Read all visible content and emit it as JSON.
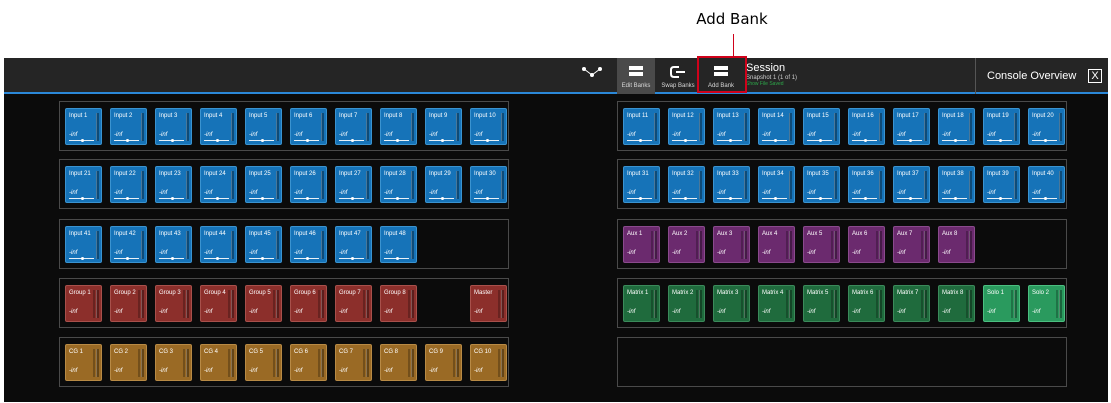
{
  "annotation": {
    "label": "Add Bank"
  },
  "toolbar": {
    "routing_icon": "routing-icon",
    "edit_banks": "Edit Banks",
    "swap_banks": "Swap Banks",
    "add_bank": "Add Bank",
    "session_title": "Session",
    "session_sub": "Snapshot 1 (1 of 1)",
    "session_status": "Show File Saved",
    "console_overview": "Console Overview",
    "close_label": "X"
  },
  "left_banks": [
    {
      "kind": "input",
      "tiles": [
        {
          "name": "Input 1",
          "level": "-inf"
        },
        {
          "name": "Input 2",
          "level": "-inf"
        },
        {
          "name": "Input 3",
          "level": "-inf"
        },
        {
          "name": "Input 4",
          "level": "-inf"
        },
        {
          "name": "Input 5",
          "level": "-inf"
        },
        {
          "name": "Input 6",
          "level": "-inf"
        },
        {
          "name": "Input 7",
          "level": "-inf"
        },
        {
          "name": "Input 8",
          "level": "-inf"
        },
        {
          "name": "Input 9",
          "level": "-inf"
        },
        {
          "name": "Input 10",
          "level": "-inf"
        }
      ]
    },
    {
      "kind": "input",
      "tiles": [
        {
          "name": "Input 21",
          "level": "-inf"
        },
        {
          "name": "Input 22",
          "level": "-inf"
        },
        {
          "name": "Input 23",
          "level": "-inf"
        },
        {
          "name": "Input 24",
          "level": "-inf"
        },
        {
          "name": "Input 25",
          "level": "-inf"
        },
        {
          "name": "Input 26",
          "level": "-inf"
        },
        {
          "name": "Input 27",
          "level": "-inf"
        },
        {
          "name": "Input 28",
          "level": "-inf"
        },
        {
          "name": "Input 29",
          "level": "-inf"
        },
        {
          "name": "Input 30",
          "level": "-inf"
        }
      ]
    },
    {
      "kind": "input",
      "tiles": [
        {
          "name": "Input 41",
          "level": "-inf"
        },
        {
          "name": "Input 42",
          "level": "-inf"
        },
        {
          "name": "Input 43",
          "level": "-inf"
        },
        {
          "name": "Input 44",
          "level": "-inf"
        },
        {
          "name": "Input 45",
          "level": "-inf"
        },
        {
          "name": "Input 46",
          "level": "-inf"
        },
        {
          "name": "Input 47",
          "level": "-inf"
        },
        {
          "name": "Input 48",
          "level": "-inf"
        }
      ]
    },
    {
      "kind": "group",
      "tiles": [
        {
          "name": "Group 1",
          "level": "-inf"
        },
        {
          "name": "Group 2",
          "level": "-inf"
        },
        {
          "name": "Group 3",
          "level": "-inf"
        },
        {
          "name": "Group 4",
          "level": "-inf"
        },
        {
          "name": "Group 5",
          "level": "-inf"
        },
        {
          "name": "Group 6",
          "level": "-inf"
        },
        {
          "name": "Group 7",
          "level": "-inf"
        },
        {
          "name": "Group 8",
          "level": "-inf"
        },
        {
          "name": "",
          "level": ""
        },
        {
          "name": "Master",
          "level": "-inf"
        }
      ]
    },
    {
      "kind": "cg",
      "tiles": [
        {
          "name": "CG 1",
          "level": "-inf"
        },
        {
          "name": "CG 2",
          "level": "-inf"
        },
        {
          "name": "CG 3",
          "level": "-inf"
        },
        {
          "name": "CG 4",
          "level": "-inf"
        },
        {
          "name": "CG 5",
          "level": "-inf"
        },
        {
          "name": "CG 6",
          "level": "-inf"
        },
        {
          "name": "CG 7",
          "level": "-inf"
        },
        {
          "name": "CG 8",
          "level": "-inf"
        },
        {
          "name": "CG 9",
          "level": "-inf"
        },
        {
          "name": "CG 10",
          "level": "-inf"
        }
      ]
    }
  ],
  "right_banks": [
    {
      "kind": "input",
      "tiles": [
        {
          "name": "Input 11",
          "level": "-inf"
        },
        {
          "name": "Input 12",
          "level": "-inf"
        },
        {
          "name": "Input 13",
          "level": "-inf"
        },
        {
          "name": "Input 14",
          "level": "-inf"
        },
        {
          "name": "Input 15",
          "level": "-inf"
        },
        {
          "name": "Input 16",
          "level": "-inf"
        },
        {
          "name": "Input 17",
          "level": "-inf"
        },
        {
          "name": "Input 18",
          "level": "-inf"
        },
        {
          "name": "Input 19",
          "level": "-inf"
        },
        {
          "name": "Input 20",
          "level": "-inf"
        }
      ]
    },
    {
      "kind": "input",
      "tiles": [
        {
          "name": "Input 31",
          "level": "-inf"
        },
        {
          "name": "Input 32",
          "level": "-inf"
        },
        {
          "name": "Input 33",
          "level": "-inf"
        },
        {
          "name": "Input 34",
          "level": "-inf"
        },
        {
          "name": "Input 35",
          "level": "-inf"
        },
        {
          "name": "Input 36",
          "level": "-inf"
        },
        {
          "name": "Input 37",
          "level": "-inf"
        },
        {
          "name": "Input 38",
          "level": "-inf"
        },
        {
          "name": "Input 39",
          "level": "-inf"
        },
        {
          "name": "Input 40",
          "level": "-inf"
        }
      ]
    },
    {
      "kind": "aux",
      "tiles": [
        {
          "name": "Aux 1",
          "level": "-inf"
        },
        {
          "name": "Aux 2",
          "level": "-inf"
        },
        {
          "name": "Aux 3",
          "level": "-inf"
        },
        {
          "name": "Aux 4",
          "level": "-inf"
        },
        {
          "name": "Aux 5",
          "level": "-inf"
        },
        {
          "name": "Aux 6",
          "level": "-inf"
        },
        {
          "name": "Aux 7",
          "level": "-inf"
        },
        {
          "name": "Aux 8",
          "level": "-inf"
        }
      ]
    },
    {
      "kind": "matrix",
      "tiles": [
        {
          "name": "Matrix 1",
          "level": "-inf"
        },
        {
          "name": "Matrix 2",
          "level": "-inf"
        },
        {
          "name": "Matrix 3",
          "level": "-inf"
        },
        {
          "name": "Matrix 4",
          "level": "-inf"
        },
        {
          "name": "Matrix 5",
          "level": "-inf"
        },
        {
          "name": "Matrix 6",
          "level": "-inf"
        },
        {
          "name": "Matrix 7",
          "level": "-inf"
        },
        {
          "name": "Matrix 8",
          "level": "-inf"
        },
        {
          "name": "Solo 1",
          "level": "-inf",
          "kind": "solo"
        },
        {
          "name": "Solo 2",
          "level": "-inf",
          "kind": "solo"
        }
      ]
    },
    {
      "kind": "empty",
      "tiles": []
    }
  ],
  "colors": {
    "input": "#1673b8",
    "aux": "#6b2a6e",
    "group": "#8c2f2b",
    "cg": "#9a6a25",
    "matrix": "#1f6b3d",
    "solo": "#2a9a5e",
    "accent": "#2b88d8",
    "annotation": "#d0021b"
  }
}
